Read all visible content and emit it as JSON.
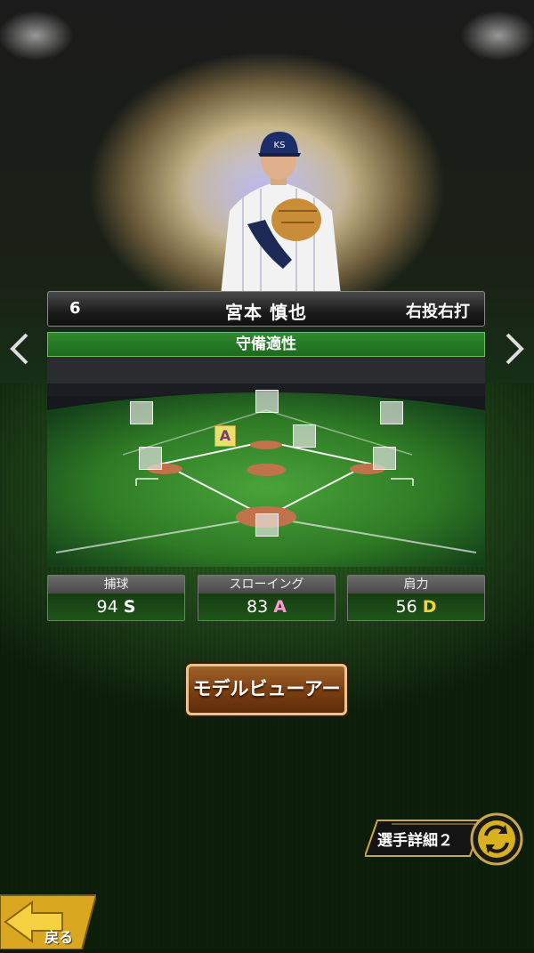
{
  "player": {
    "number": "6",
    "name": "宮本 慎也",
    "handedness": "右投右打"
  },
  "defense": {
    "title": "守備適性",
    "positions": [
      {
        "id": "lf",
        "grade": ""
      },
      {
        "id": "cf",
        "grade": ""
      },
      {
        "id": "rf",
        "grade": ""
      },
      {
        "id": "ss",
        "grade": "A"
      },
      {
        "id": "2b",
        "grade": ""
      },
      {
        "id": "3b",
        "grade": ""
      },
      {
        "id": "1b",
        "grade": ""
      },
      {
        "id": "c",
        "grade": ""
      }
    ],
    "ss_grade": "A"
  },
  "stats": [
    {
      "label": "捕球",
      "value": "94",
      "grade": "S"
    },
    {
      "label": "スローイング",
      "value": "83",
      "grade": "A"
    },
    {
      "label": "肩力",
      "value": "56",
      "grade": "D"
    }
  ],
  "buttons": {
    "model_viewer": "モデルビューアー",
    "player_detail": "選手詳細２",
    "back": "戻る"
  },
  "icons": {
    "prev": "chevron-left-icon",
    "next": "chevron-right-icon",
    "refresh": "refresh-icon",
    "back_arrow": "arrow-left-icon"
  },
  "colors": {
    "grade_S": "#ffffff",
    "grade_A": "#ff9ad4",
    "grade_D": "#f2d43a",
    "panel_green": "#1f5419"
  }
}
